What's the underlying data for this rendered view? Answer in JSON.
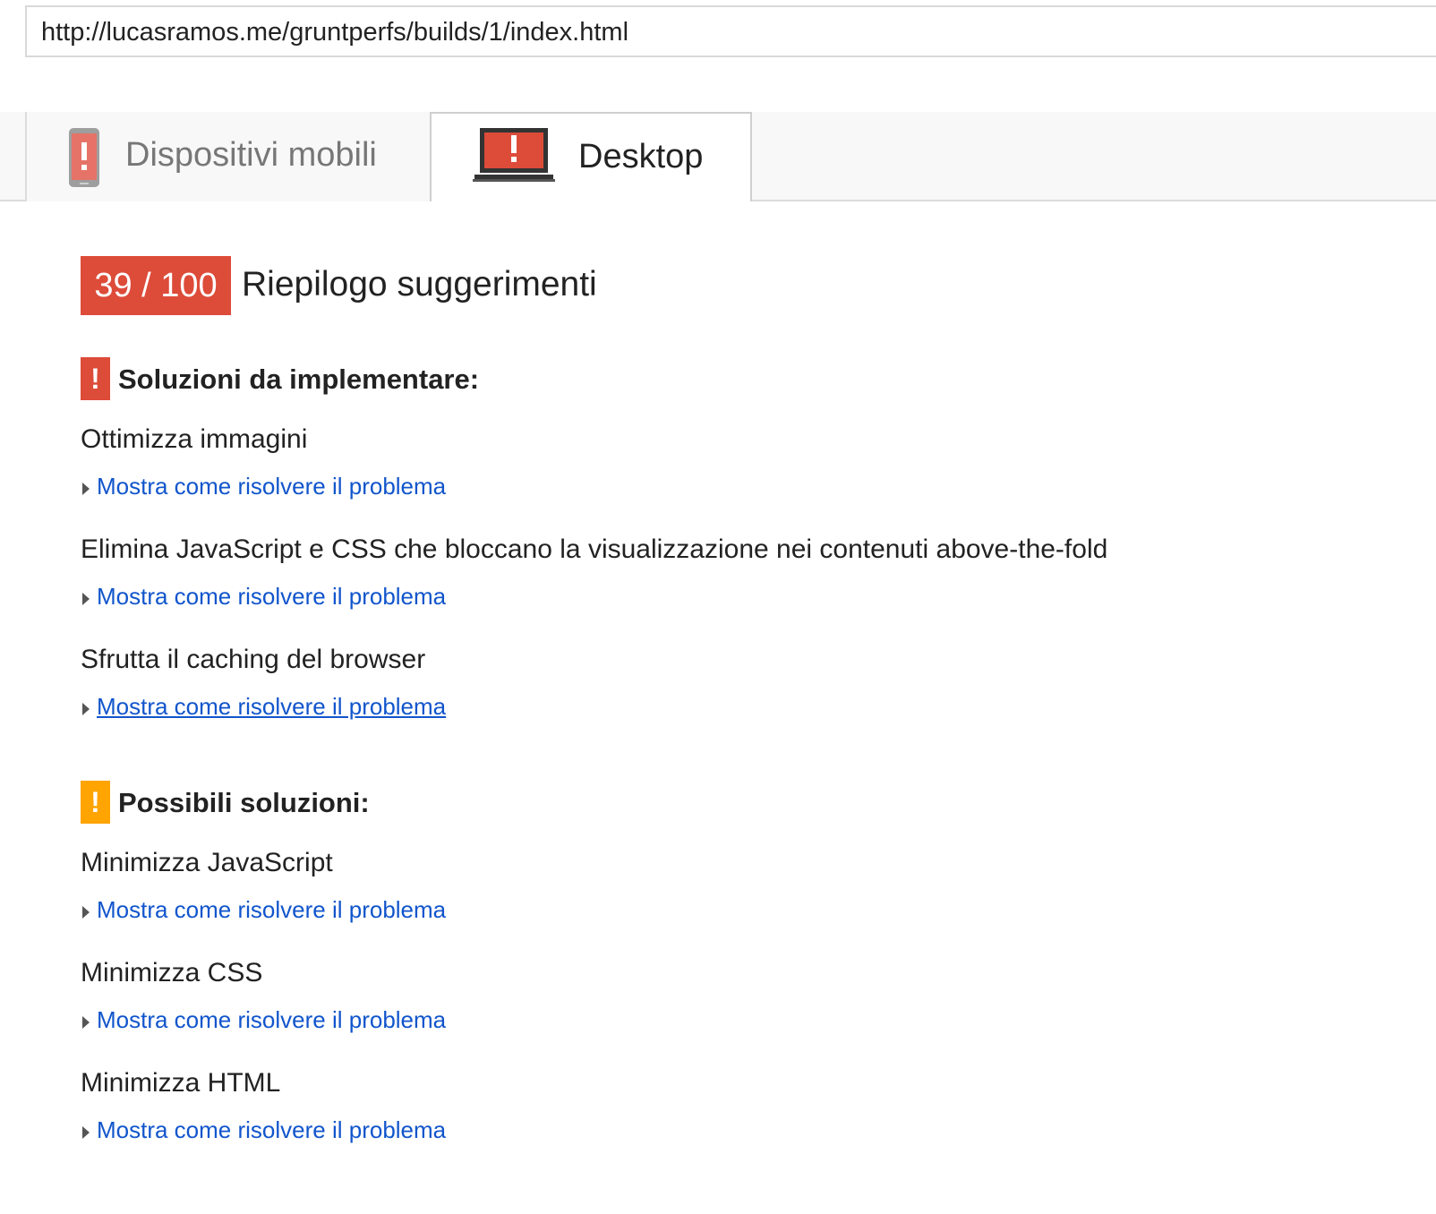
{
  "address_bar": {
    "url": "http://lucasramos.me/gruntperfs/builds/1/index.html"
  },
  "tabs": [
    {
      "label": "Dispositivi mobili",
      "icon": "mobile-phone-warning-icon",
      "selected": false
    },
    {
      "label": "Desktop",
      "icon": "laptop-warning-icon",
      "selected": true
    }
  ],
  "summary": {
    "score": "39 / 100",
    "title": "Riepilogo suggerimenti",
    "score_color": "#dd4b39"
  },
  "sections": [
    {
      "title": "Soluzioni da implementare:",
      "badge": "!",
      "badge_color": "#dd4b39",
      "rules": [
        {
          "title": "Ottimizza immagini",
          "link": "Mostra come risolvere il problema"
        },
        {
          "title": "Elimina JavaScript e CSS che bloccano la visualizzazione nei contenuti above-the-fold",
          "link": "Mostra come risolvere il problema"
        },
        {
          "title": "Sfrutta il caching del browser",
          "link": "Mostra come risolvere il problema"
        }
      ]
    },
    {
      "title": "Possibili soluzioni:",
      "badge": "!",
      "badge_color": "#ffa400",
      "rules": [
        {
          "title": "Minimizza JavaScript",
          "link": "Mostra come risolvere il problema"
        },
        {
          "title": "Minimizza CSS",
          "link": "Mostra come risolvere il problema"
        },
        {
          "title": "Minimizza HTML",
          "link": "Mostra come risolvere il problema"
        }
      ]
    }
  ],
  "colors": {
    "link": "#1155cc",
    "text": "#222222",
    "tab_inactive_text": "#777777"
  }
}
